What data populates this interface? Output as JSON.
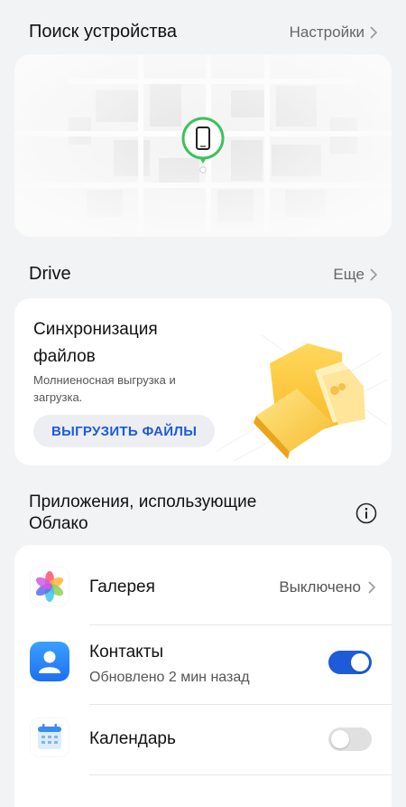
{
  "find_device": {
    "title": "Поиск устройства",
    "link_label": "Настройки"
  },
  "drive": {
    "title": "Drive",
    "link_label": "Еще",
    "card_title": "Синхронизация файлов",
    "card_subtitle": "Молниеносная выгрузка и загрузка.",
    "upload_button": "ВЫГРУЗИТЬ ФАЙЛЫ"
  },
  "apps": {
    "title": "Приложения, использующие Облако",
    "items": [
      {
        "name": "Галерея",
        "value": "Выключено",
        "icon": "gallery-icon"
      },
      {
        "name": "Контакты",
        "subtitle": "Обновлено 2 мин назад",
        "toggle": true,
        "icon": "contacts-icon"
      },
      {
        "name": "Календарь",
        "toggle": false,
        "icon": "calendar-icon"
      }
    ]
  },
  "colors": {
    "accent": "#1e5bd8",
    "pin_green": "#3cc25a",
    "background": "#f1f3f5"
  }
}
